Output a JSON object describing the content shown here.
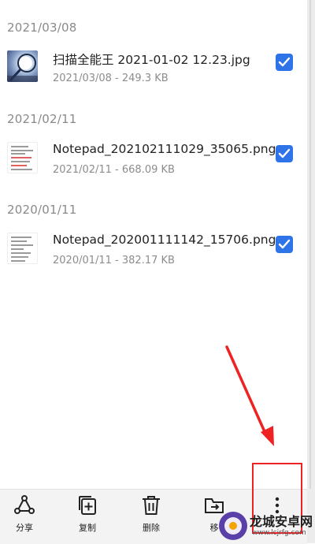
{
  "groups": [
    {
      "date": "2021/03/08",
      "file": {
        "name": "扫描全能王 2021-01-02 12.23.jpg",
        "meta": "2021/03/08 - 249.3 KB",
        "thumb": "photo-thumbnail"
      }
    },
    {
      "date": "2021/02/11",
      "file": {
        "name": "Notepad_202102111029_35065.png",
        "meta": "2021/02/11 - 668.09 KB",
        "thumb": "document-thumbnail"
      }
    },
    {
      "date": "2020/01/11",
      "file": {
        "name": "Notepad_202001111142_15706.png",
        "meta": "2020/01/11 - 382.17 KB",
        "thumb": "document-thumbnail"
      }
    }
  ],
  "toolbar": {
    "share": {
      "label": "分享",
      "icon": "share-icon"
    },
    "copy": {
      "label": "复制",
      "icon": "copy-icon"
    },
    "delete": {
      "label": "删除",
      "icon": "trash-icon"
    },
    "move": {
      "label": "移",
      "icon": "move-folder-icon"
    },
    "more": {
      "icon": "more-vertical-icon"
    }
  },
  "watermark": {
    "title": "龙城安卓网",
    "url": "www.lcjrfg.com"
  },
  "colors": {
    "accent": "#2f73e8",
    "annotation": "#ee2222",
    "bar_bg": "#f3f3f3"
  }
}
